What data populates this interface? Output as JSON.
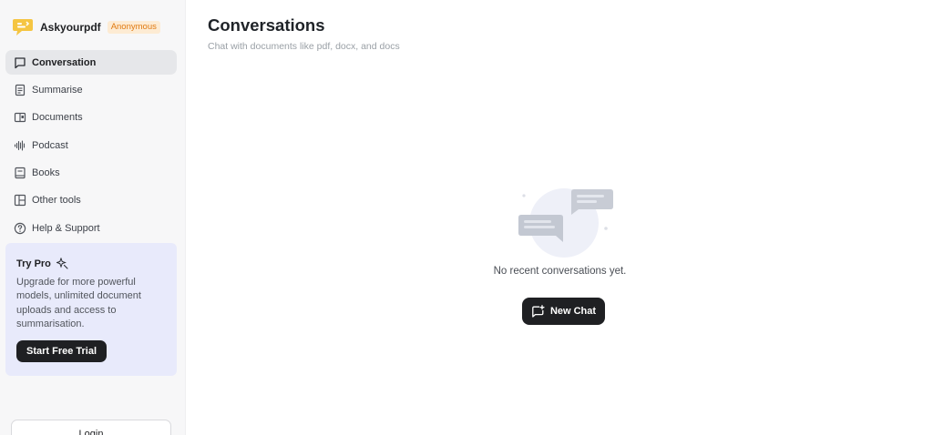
{
  "brand": {
    "name": "Askyourpdf",
    "badge": "Anonymous",
    "logo_color": "#f5c542",
    "badge_color": "#e07a12"
  },
  "nav": {
    "items": [
      {
        "label": "Conversation",
        "icon": "chat-bubble-icon",
        "active": true
      },
      {
        "label": "Summarise",
        "icon": "document-lines-icon"
      },
      {
        "label": "Documents",
        "icon": "book-open-icon"
      },
      {
        "label": "Podcast",
        "icon": "waveform-icon"
      },
      {
        "label": "Books",
        "icon": "book-icon"
      },
      {
        "label": "Other tools",
        "icon": "layout-grid-icon"
      },
      {
        "label": "Help & Support",
        "icon": "help-circle-icon"
      }
    ]
  },
  "promo": {
    "title": "Try Pro",
    "icon": "sparkle-icon",
    "text": "Upgrade for more powerful models, unlimited document uploads and access to summarisation.",
    "button": "Start Free Trial",
    "bg_color": "#e8eafb"
  },
  "login": {
    "label": "Login"
  },
  "main": {
    "title": "Conversations",
    "subtitle": "Chat with documents like pdf, docx, and docs",
    "empty_text": "No recent conversations yet.",
    "new_chat_button": "New Chat",
    "empty_icon": "chat-bubbles-illustration-icon"
  },
  "colors": {
    "dark_button": "#1f2023",
    "sidebar_bg": "#f7f7f8",
    "active_item_bg": "#e6e7ea"
  }
}
